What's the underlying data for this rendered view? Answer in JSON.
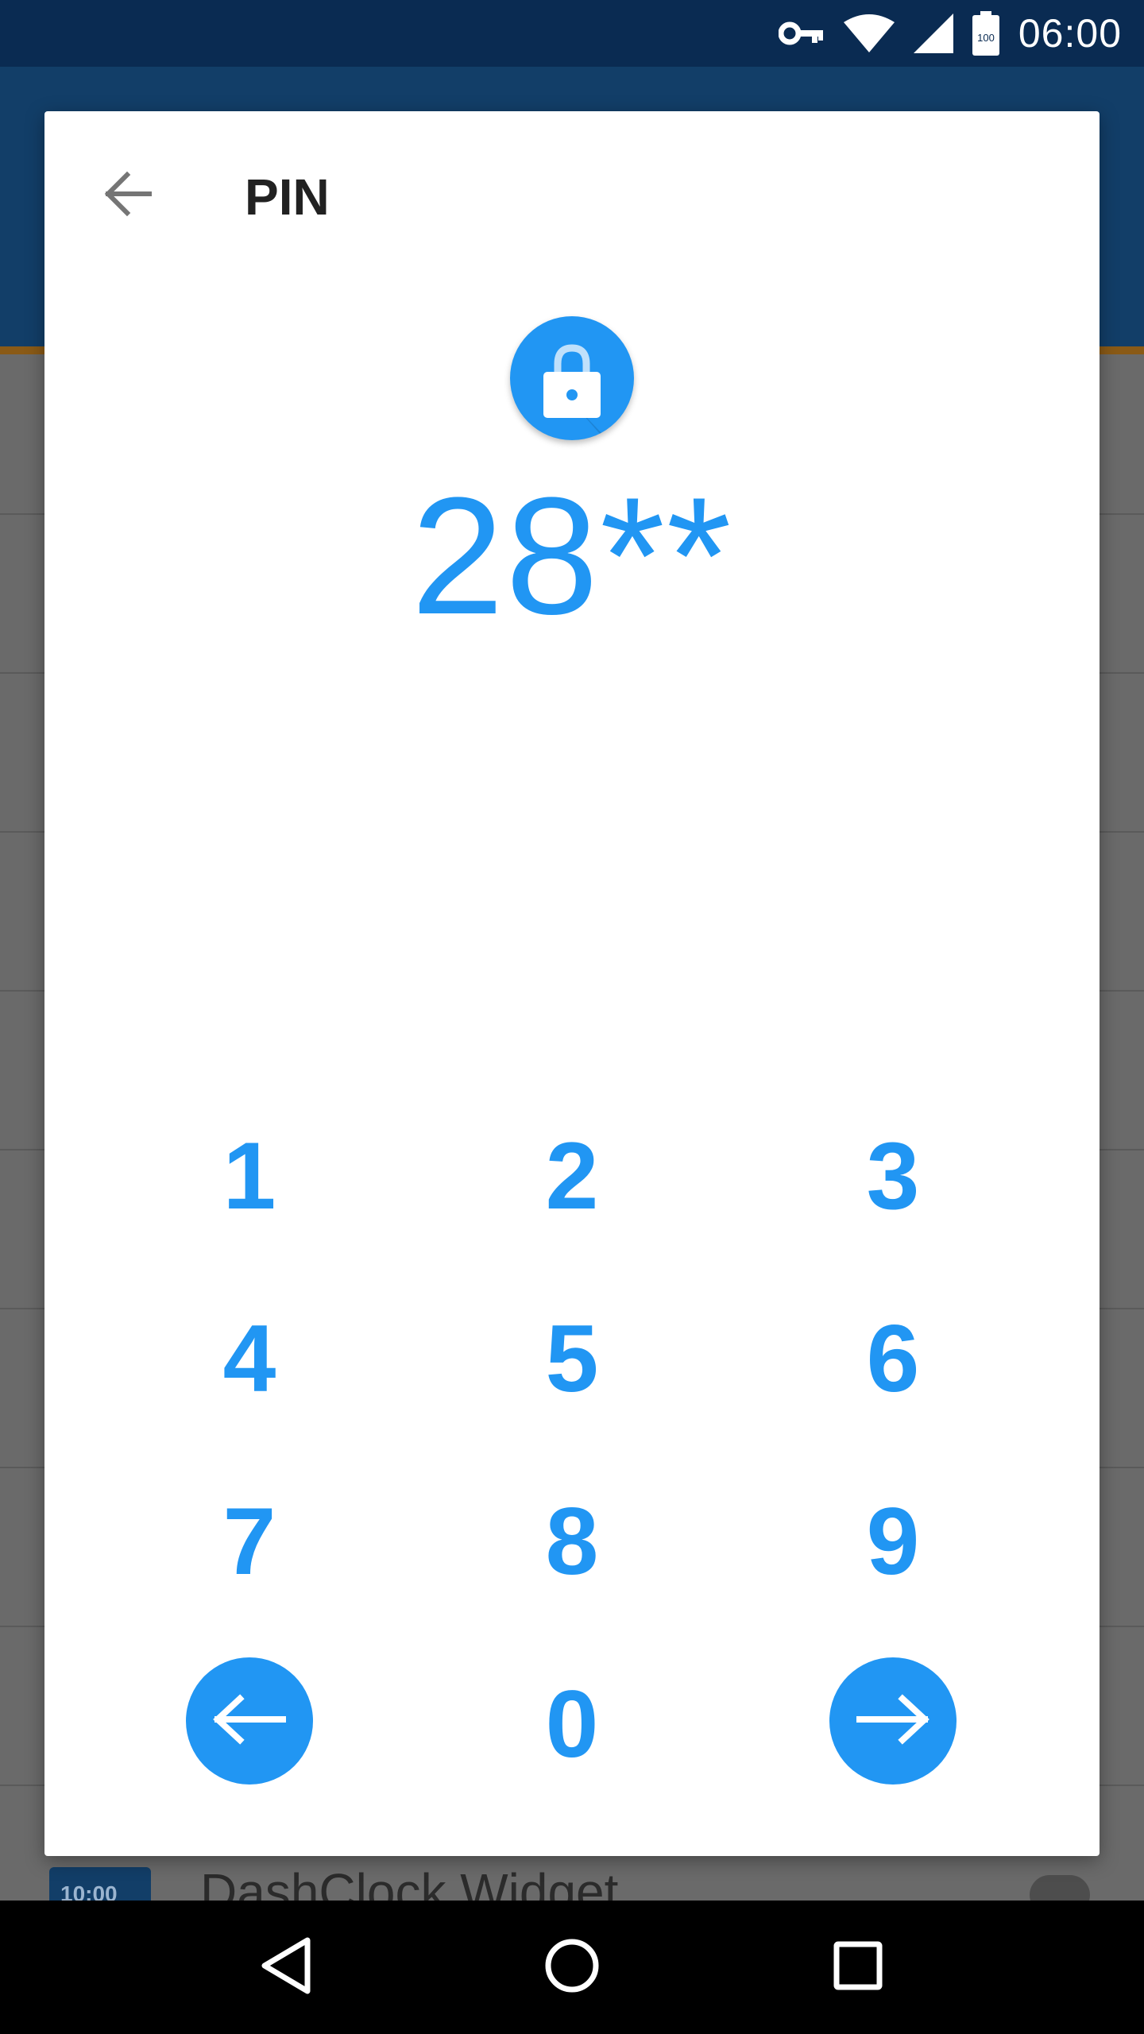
{
  "status_bar": {
    "time": "06:00",
    "battery_level": "100",
    "icons": [
      "vpn-key-icon",
      "wifi-icon",
      "cell-signal-icon",
      "battery-icon"
    ]
  },
  "background_app": {
    "list_item_title": "DashClock Widget",
    "widget_icon_text": "10:00"
  },
  "dialog": {
    "title": "PIN",
    "pin_entry": "28**",
    "keypad": {
      "keys": [
        "1",
        "2",
        "3",
        "4",
        "5",
        "6",
        "7",
        "8",
        "9",
        "0"
      ],
      "backspace_icon": "arrow-left-icon",
      "confirm_icon": "arrow-right-icon"
    }
  },
  "colors": {
    "accent": "#2196f3",
    "status_bar": "#0a2b52",
    "title_text": "#212121"
  }
}
